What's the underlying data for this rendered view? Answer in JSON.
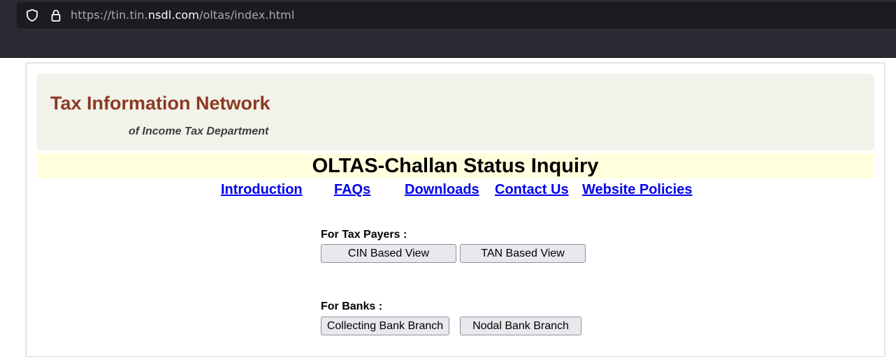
{
  "browser": {
    "url_prefix": "https://tin.tin.",
    "url_domain": "nsdl.com",
    "url_path": "/oltas/index.html",
    "icons": [
      "shield-icon",
      "lock-icon"
    ]
  },
  "header": {
    "title": "Tax Information Network",
    "subtitle": "of Income Tax Department",
    "title_color": "#8b3a22"
  },
  "page": {
    "title": "OLTAS-Challan Status Inquiry"
  },
  "nav": {
    "introduction": "Introduction",
    "faqs": "FAQs",
    "downloads": "Downloads",
    "contact": "Contact Us",
    "policies": "Website Policies",
    "link_color": "#0000ee"
  },
  "tax_payers": {
    "label": "For Tax Payers :",
    "cin_button": "CIN Based View",
    "tan_button": "TAN Based View"
  },
  "banks": {
    "label": "For Banks :",
    "collecting_button": "Collecting Bank Branch",
    "nodal_button": "Nodal Bank Branch"
  }
}
